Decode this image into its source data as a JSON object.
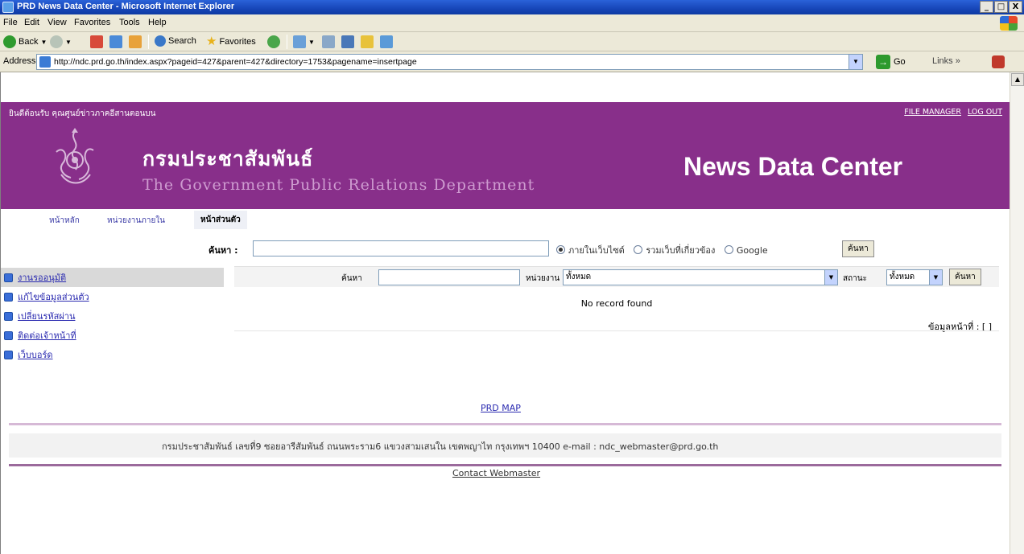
{
  "window": {
    "title": "PRD News Data Center - Microsoft Internet Explorer",
    "controls": [
      "_",
      "□",
      "X"
    ]
  },
  "menu": [
    "File",
    "Edit",
    "View",
    "Favorites",
    "Tools",
    "Help"
  ],
  "toolbar": {
    "back": "Back",
    "search": "Search",
    "favorites": "Favorites"
  },
  "address": {
    "label": "Address",
    "url": "http://ndc.prd.go.th/index.aspx?pageid=427&parent=427&directory=1753&pagename=insertpage",
    "go": "Go",
    "links": "Links"
  },
  "header": {
    "welcome": "ยินดีต้อนรับ คุณศูนย์ข่าวภาคอีสานตอนบน",
    "file_manager": "FILE MANAGER",
    "logout": "LOG OUT",
    "dept_th": "กรมประชาสัมพันธ์",
    "dept_en": "The Government Public Relations Department",
    "brand": "News Data Center",
    "brand_color": "#882f8a"
  },
  "nav": {
    "home": "หน้าหลัก",
    "internal": "หน่วยงานภายใน",
    "personal": "หน้าส่วนตัว"
  },
  "search": {
    "label": "ค้นหา :",
    "value": "",
    "options": [
      "ภายในเว็บไซต์",
      "รวมเว็บที่เกี่ยวข้อง",
      "Google"
    ],
    "selected": "ภายในเว็บไซต์",
    "button": "ค้นหา"
  },
  "sidebar": {
    "items": [
      {
        "label": "งานรออนุมัติ",
        "active": true
      },
      {
        "label": "แก้ไขข้อมูลส่วนตัว",
        "active": false
      },
      {
        "label": "เปลี่ยนรหัสผ่าน",
        "active": false
      },
      {
        "label": "ติดต่อเจ้าหน้าที่",
        "active": false
      },
      {
        "label": "เว็บบอร์ด",
        "active": false
      }
    ]
  },
  "filter": {
    "search_label": "ค้นหา",
    "search_value": "",
    "unit_label": "หน่วยงาน",
    "unit_value": "ทั้งหมด",
    "status_label": "สถานะ",
    "status_value": "ทั้งหมด",
    "button": "ค้นหา"
  },
  "results": {
    "empty_text": "No record found",
    "page_info": "ข้อมูลหน้าที่ :  [ ]"
  },
  "footer": {
    "map_link": "PRD MAP",
    "address": "กรมประชาสัมพันธ์ เลขที่9 ซอยอารีสัมพันธ์ ถนนพระราม6 แขวงสามเสนใน เขตพญาไท กรุงเทพฯ 10400 e-mail : ndc_webmaster@prd.go.th",
    "contact": "Contact Webmaster"
  }
}
